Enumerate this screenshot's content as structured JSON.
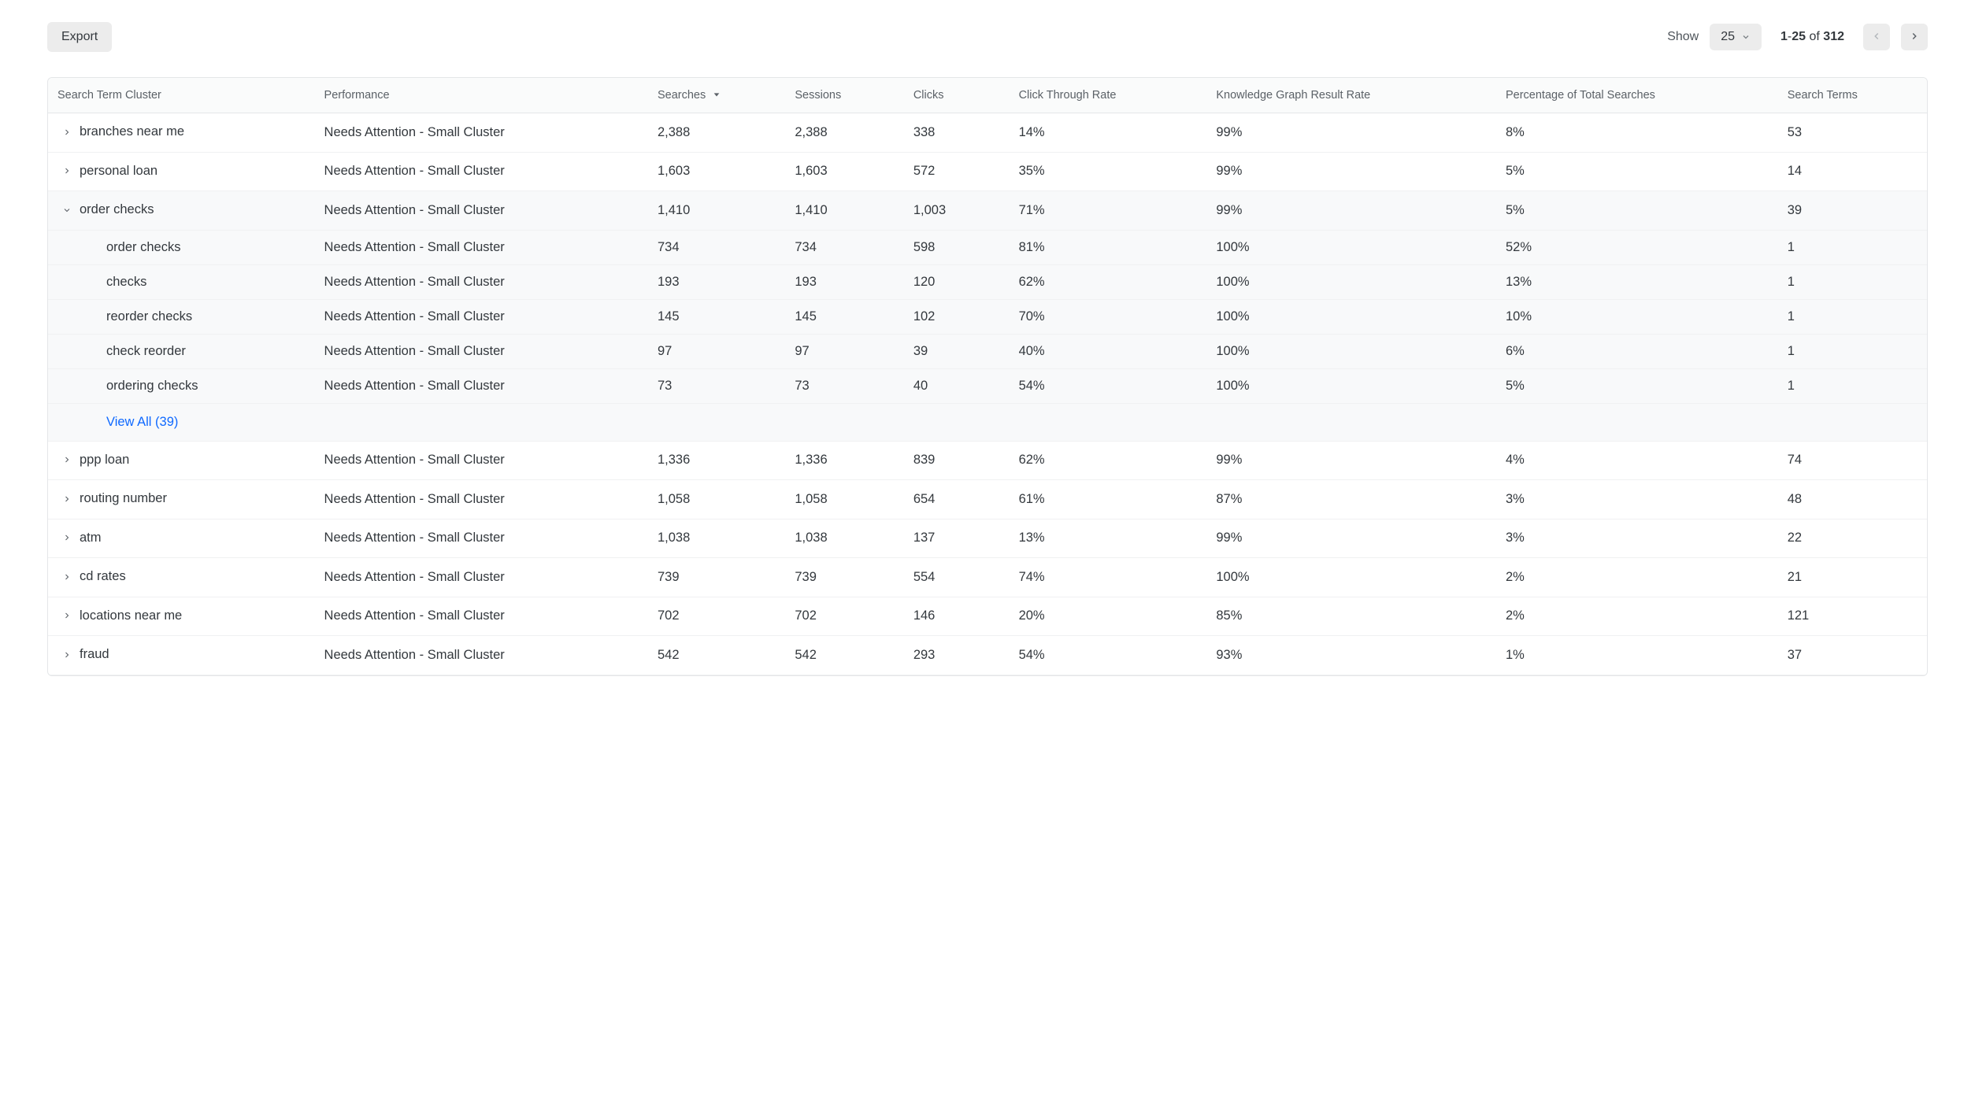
{
  "toolbar": {
    "export_label": "Export",
    "show_label": "Show",
    "per_page": "25",
    "range_from": "1",
    "range_to": "25",
    "range_of_label": "of",
    "total_rows": "312"
  },
  "table": {
    "columns": {
      "cluster": "Search Term Cluster",
      "performance": "Performance",
      "searches": "Searches",
      "sessions": "Sessions",
      "clicks": "Clicks",
      "ctr": "Click Through Rate",
      "kg_rate": "Knowledge Graph Result Rate",
      "pct_total": "Percentage of Total Searches",
      "terms": "Search Terms"
    },
    "sort_column": "searches",
    "sort_dir": "desc",
    "rows": [
      {
        "cluster": "branches near me",
        "performance": "Needs Attention - Small Cluster",
        "searches": "2,388",
        "sessions": "2,388",
        "clicks": "338",
        "ctr": "14%",
        "kg": "99%",
        "pct": "8%",
        "terms": "53",
        "expanded": false
      },
      {
        "cluster": "personal loan",
        "performance": "Needs Attention - Small Cluster",
        "searches": "1,603",
        "sessions": "1,603",
        "clicks": "572",
        "ctr": "35%",
        "kg": "99%",
        "pct": "5%",
        "terms": "14",
        "expanded": false
      },
      {
        "cluster": "order checks",
        "performance": "Needs Attention - Small Cluster",
        "searches": "1,410",
        "sessions": "1,410",
        "clicks": "1,003",
        "ctr": "71%",
        "kg": "99%",
        "pct": "5%",
        "terms": "39",
        "expanded": true,
        "children": [
          {
            "cluster": "order checks",
            "performance": "Needs Attention - Small Cluster",
            "searches": "734",
            "sessions": "734",
            "clicks": "598",
            "ctr": "81%",
            "kg": "100%",
            "pct": "52%",
            "terms": "1"
          },
          {
            "cluster": "checks",
            "performance": "Needs Attention - Small Cluster",
            "searches": "193",
            "sessions": "193",
            "clicks": "120",
            "ctr": "62%",
            "kg": "100%",
            "pct": "13%",
            "terms": "1"
          },
          {
            "cluster": "reorder checks",
            "performance": "Needs Attention - Small Cluster",
            "searches": "145",
            "sessions": "145",
            "clicks": "102",
            "ctr": "70%",
            "kg": "100%",
            "pct": "10%",
            "terms": "1"
          },
          {
            "cluster": "check reorder",
            "performance": "Needs Attention - Small Cluster",
            "searches": "97",
            "sessions": "97",
            "clicks": "39",
            "ctr": "40%",
            "kg": "100%",
            "pct": "6%",
            "terms": "1"
          },
          {
            "cluster": "ordering checks",
            "performance": "Needs Attention - Small Cluster",
            "searches": "73",
            "sessions": "73",
            "clicks": "40",
            "ctr": "54%",
            "kg": "100%",
            "pct": "5%",
            "terms": "1"
          }
        ],
        "view_all": "View All (39)"
      },
      {
        "cluster": "ppp loan",
        "performance": "Needs Attention - Small Cluster",
        "searches": "1,336",
        "sessions": "1,336",
        "clicks": "839",
        "ctr": "62%",
        "kg": "99%",
        "pct": "4%",
        "terms": "74",
        "expanded": false
      },
      {
        "cluster": "routing number",
        "performance": "Needs Attention - Small Cluster",
        "searches": "1,058",
        "sessions": "1,058",
        "clicks": "654",
        "ctr": "61%",
        "kg": "87%",
        "pct": "3%",
        "terms": "48",
        "expanded": false
      },
      {
        "cluster": "atm",
        "performance": "Needs Attention - Small Cluster",
        "searches": "1,038",
        "sessions": "1,038",
        "clicks": "137",
        "ctr": "13%",
        "kg": "99%",
        "pct": "3%",
        "terms": "22",
        "expanded": false
      },
      {
        "cluster": "cd rates",
        "performance": "Needs Attention - Small Cluster",
        "searches": "739",
        "sessions": "739",
        "clicks": "554",
        "ctr": "74%",
        "kg": "100%",
        "pct": "2%",
        "terms": "21",
        "expanded": false
      },
      {
        "cluster": "locations near me",
        "performance": "Needs Attention - Small Cluster",
        "searches": "702",
        "sessions": "702",
        "clicks": "146",
        "ctr": "20%",
        "kg": "85%",
        "pct": "2%",
        "terms": "121",
        "expanded": false
      },
      {
        "cluster": "fraud",
        "performance": "Needs Attention - Small Cluster",
        "searches": "542",
        "sessions": "542",
        "clicks": "293",
        "ctr": "54%",
        "kg": "93%",
        "pct": "1%",
        "terms": "37",
        "expanded": false
      }
    ]
  }
}
